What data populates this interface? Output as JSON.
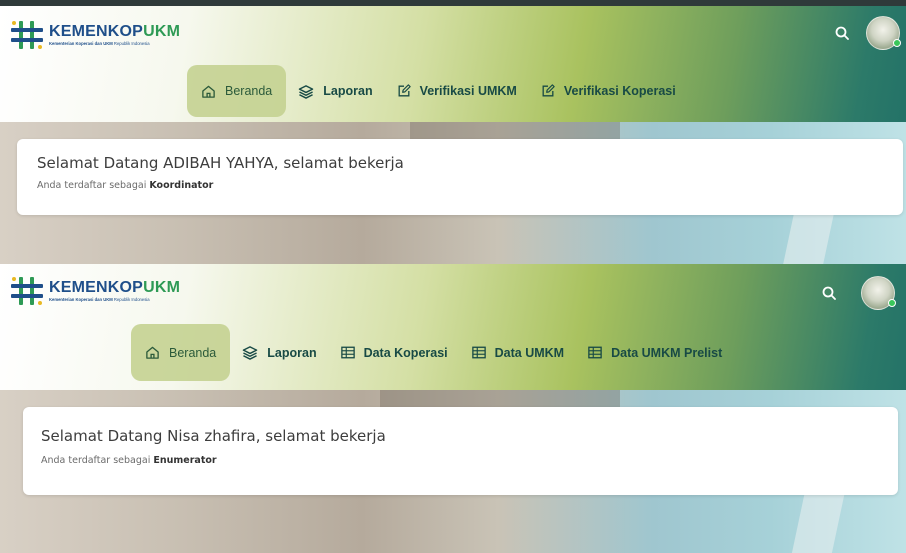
{
  "brand": {
    "name_part1": "KEMENKOP",
    "name_part2": "UKM",
    "tagline_part1": "Kementerian Koperasi dan UKM",
    "tagline_part2": " Republik Indonesia"
  },
  "icons": {
    "search": "search-icon",
    "home": "home-icon",
    "layers": "layers-icon",
    "edit": "edit-icon",
    "table": "table-icon"
  },
  "colors": {
    "nav_text": "#184a45",
    "active_bg": "#c4d191",
    "status_online": "#39c65a"
  },
  "screens": [
    {
      "nav": [
        {
          "label": "Beranda",
          "icon": "home-icon",
          "active": true
        },
        {
          "label": "Laporan",
          "icon": "layers-icon",
          "active": false
        },
        {
          "label": "Verifikasi UMKM",
          "icon": "edit-icon",
          "active": false
        },
        {
          "label": "Verifikasi Koperasi",
          "icon": "edit-icon",
          "active": false
        }
      ],
      "welcome": {
        "title": "Selamat Datang ADIBAH YAHYA, selamat bekerja",
        "subtitle_prefix": "Anda terdaftar sebagai ",
        "role": "Koordinator"
      }
    },
    {
      "nav": [
        {
          "label": "Beranda",
          "icon": "home-icon",
          "active": true
        },
        {
          "label": "Laporan",
          "icon": "layers-icon",
          "active": false
        },
        {
          "label": "Data Koperasi",
          "icon": "table-icon",
          "active": false
        },
        {
          "label": "Data UMKM",
          "icon": "table-icon",
          "active": false
        },
        {
          "label": "Data UMKM Prelist",
          "icon": "table-icon",
          "active": false
        }
      ],
      "welcome": {
        "title": "Selamat Datang Nisa zhafira, selamat bekerja",
        "subtitle_prefix": "Anda terdaftar sebagai ",
        "role": "Enumerator"
      }
    }
  ]
}
